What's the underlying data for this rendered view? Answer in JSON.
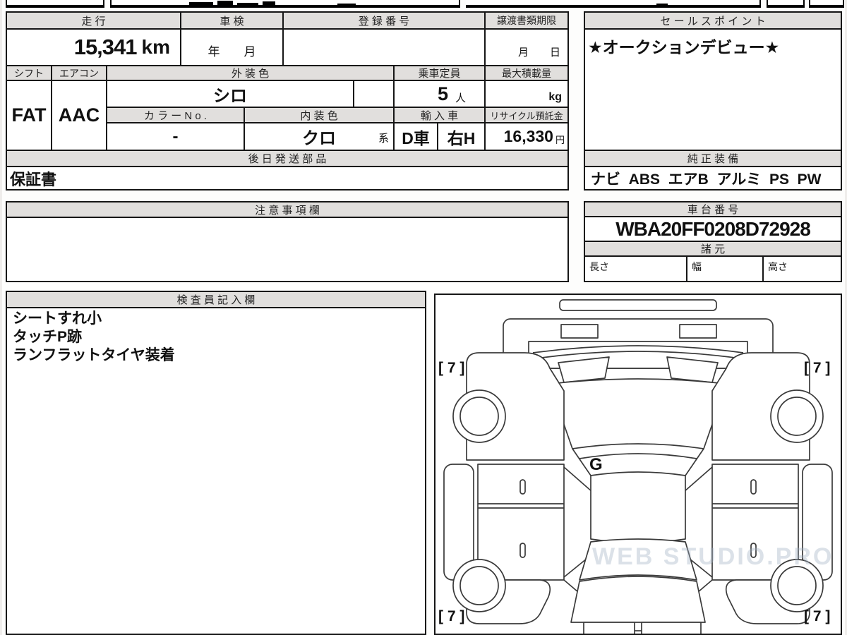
{
  "colors": {
    "border": "#161616",
    "header_bg": "#e1dfdd",
    "page_bg": "#efedeb",
    "watermark": "#a0afc3"
  },
  "top_table": {
    "mileage_label": "走 行",
    "mileage_value": "15,341",
    "mileage_unit": "km",
    "inspection_label": "車 検",
    "inspection_value": "年　　月",
    "registration_label": "登 録 番 号",
    "registration_value": "",
    "transfer_label": "譲渡書類期限",
    "transfer_value": "月　　日"
  },
  "spec_table": {
    "shift_label": "シフト",
    "shift_value": "FAT",
    "aircon_label": "エアコン",
    "aircon_value": "AAC",
    "exterior_label": "外 装 色",
    "exterior_value": "シロ",
    "capacity_label": "乗車定員",
    "capacity_value": "5",
    "capacity_unit": "人",
    "max_load_label": "最大積載量",
    "max_load_value": "",
    "max_load_unit": "kg",
    "color_no_label": "カ ラ ー N o .",
    "color_no_value": "-",
    "interior_label": "内 装 色",
    "interior_value": "クロ",
    "interior_suffix": "系",
    "import_label": "輸 入 車",
    "import_value_1": "D車",
    "import_value_2": "右H",
    "recycle_label": "リサイクル預託金",
    "recycle_value": "16,330",
    "recycle_unit": "円"
  },
  "later_parts": {
    "label": "後 日 発 送 部 品",
    "value": "保証書"
  },
  "sales_point": {
    "label": "セ ー ル ス ポ イ ン ト",
    "value": "★オークションデビュー★"
  },
  "equipment": {
    "label": "純 正 装 備",
    "value": "ナビ  ABS  エアB  アルミ  PS  PW"
  },
  "cautions": {
    "label": "注 意 事 項 欄",
    "value": ""
  },
  "chassis": {
    "label": "車 台 番 号",
    "value": "WBA20FF0208D72928"
  },
  "dimensions": {
    "label": "諸 元",
    "length_label": "長さ",
    "length_value": "",
    "width_label": "幅",
    "width_value": "",
    "height_label": "高さ",
    "height_value": ""
  },
  "inspector": {
    "label": "検 査 員 記 入 欄",
    "lines": [
      "シートすれ小",
      "タッチP跡",
      "ランフラットタイヤ装着"
    ]
  },
  "diagram": {
    "tire_front_left": "[ 7 ]",
    "tire_front_right": "[ 7 ]",
    "tire_rear_left": "[ 7 ]",
    "tire_rear_right": "[ 7 ]",
    "panel_mark": "G",
    "watermark": "WEB STUDIO.PRO"
  }
}
